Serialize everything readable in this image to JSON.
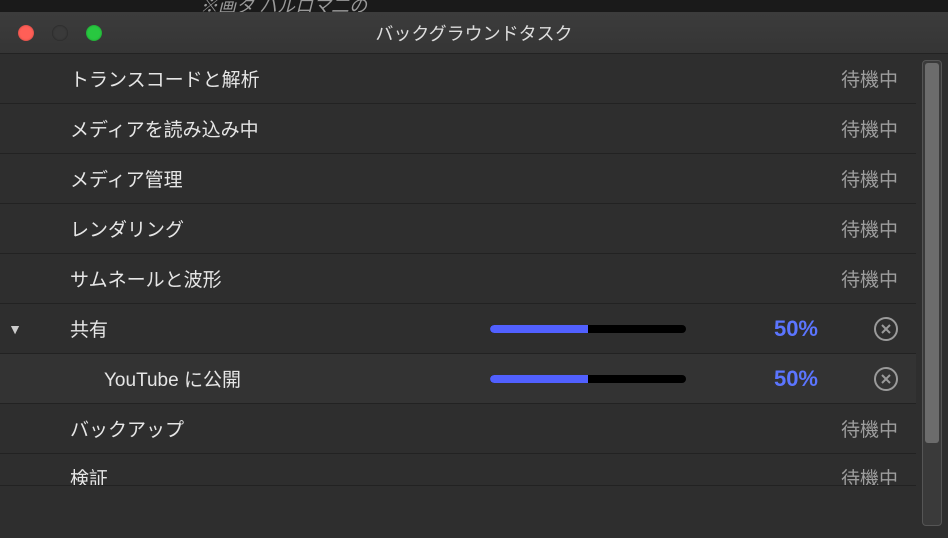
{
  "window": {
    "title": "バックグラウンドタスク"
  },
  "garbage_text": "※画タ ハルロマ二の",
  "tasks": [
    {
      "label": "トランスコードと解析",
      "status": "待機中"
    },
    {
      "label": "メディアを読み込み中",
      "status": "待機中"
    },
    {
      "label": "メディア管理",
      "status": "待機中"
    },
    {
      "label": "レンダリング",
      "status": "待機中"
    },
    {
      "label": "サムネールと波形",
      "status": "待機中"
    }
  ],
  "share": {
    "label": "共有",
    "percent_text": "50%",
    "percent": 50,
    "children": [
      {
        "label": "YouTube に公開",
        "percent_text": "50%",
        "percent": 50
      }
    ]
  },
  "tail": [
    {
      "label": "バックアップ",
      "status": "待機中"
    },
    {
      "label": "検証",
      "status": "待機中"
    }
  ]
}
